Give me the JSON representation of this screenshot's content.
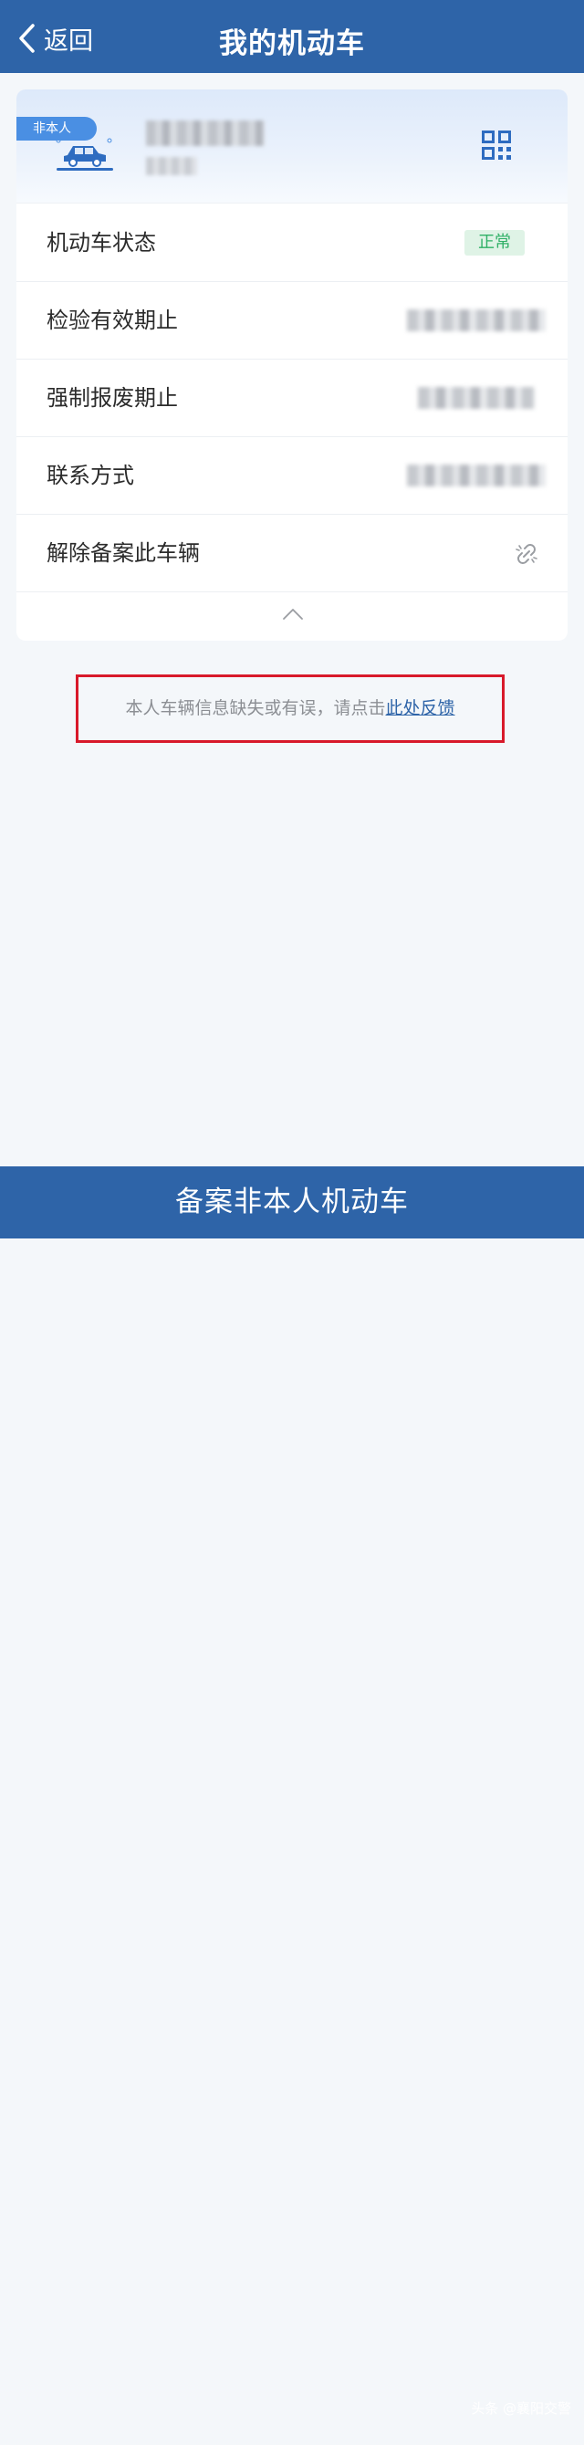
{
  "header": {
    "back_label": "返回",
    "title": "我的机动车"
  },
  "vehicle": {
    "badge": "非本人",
    "icons": [
      "car-icon",
      "qr-code-icon"
    ]
  },
  "rows": [
    {
      "label": "机动车状态",
      "value": "正常"
    },
    {
      "label": "检验有效期止"
    },
    {
      "label": "强制报废期止"
    },
    {
      "label": "联系方式"
    },
    {
      "label": "解除备案此车辆",
      "icon": "unlink-icon"
    }
  ],
  "feedback": {
    "text": "本人车辆信息缺失或有误，请点击",
    "link": "此处反馈"
  },
  "footer": {
    "button_label": "备案非本人机动车",
    "watermark": "头条 @襄阳交警"
  },
  "colors": {
    "primary": "#2e64a8",
    "status_green": "#2fb066",
    "highlight_red": "#d8192a"
  }
}
